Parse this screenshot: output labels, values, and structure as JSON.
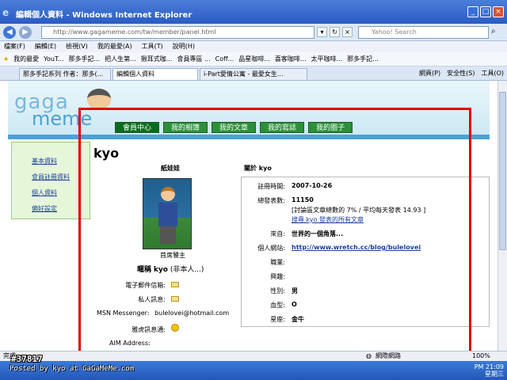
{
  "window": {
    "title": "編輯個人資料 - Windows Internet Explorer"
  },
  "address": {
    "url": "http://www.gagameme.com/tw/member/panel.html",
    "search_placeholder": "Yahoo! Search"
  },
  "menu": [
    "檔案(F)",
    "編輯(E)",
    "檢視(V)",
    "我的最愛(A)",
    "工具(T)",
    "說明(H)"
  ],
  "favorites": [
    "我的最愛",
    "YouT...",
    "那多手記...",
    "把人生第...",
    "揪耳式咖...",
    "會員專區 ...",
    "Coff...",
    "品星咖啡...",
    "喜客咖啡...",
    "太平咖啡...",
    "那多手記..."
  ],
  "tabs": [
    "那多手記系列 作者：那多(...",
    "編輯個人資料",
    "i-Part愛情公寓 - 最愛女生..."
  ],
  "command_bar": [
    "網頁(P)",
    "安全性(S)",
    "工具(O)"
  ],
  "site": {
    "logo_top": "gaga",
    "logo_bottom": "meme",
    "nav": [
      "會員中心",
      "我的相簿",
      "我的文章",
      "我的寫誌",
      "我的圈子"
    ]
  },
  "sidebar": [
    "基本資料",
    "會員註冊資料",
    "個人資料",
    "偏好設定"
  ],
  "profile": {
    "username": "kyo",
    "avatar_title": "紙娃娃",
    "avatar_caption": "首席饕主",
    "profile_label": "關於",
    "nickname_label": "暱稱",
    "nickname_value": "kyo",
    "nickname_note": "(非本人...)",
    "email_label": "電子郵件信箱:",
    "pm_label": "私人訊息:",
    "msn_label": "MSN Messenger:",
    "msn_value": "bulelovei@hotmail.com",
    "yahoo_label": "雅虎訊息通:",
    "aim_label": "AIM Address:"
  },
  "about": {
    "title": "關於 kyo",
    "rows": [
      {
        "k": "註冊時間:",
        "v": "2007-10-26"
      },
      {
        "k": "總發表數:",
        "v": "11150"
      },
      {
        "k": "",
        "v": "[討論區文章總數的 7% / 平均每天發表 14.93 ]"
      },
      {
        "k": "",
        "v": "搜尋 kyo 發表的所有文章"
      },
      {
        "k": "來自:",
        "v": "世界的一個角落..."
      },
      {
        "k": "個人網站:",
        "v": "http://www.wretch.cc/blog/bulelovei"
      },
      {
        "k": "職業:",
        "v": ""
      },
      {
        "k": "興趣:",
        "v": ""
      },
      {
        "k": "性別:",
        "v": "男"
      },
      {
        "k": "血型:",
        "v": "O"
      },
      {
        "k": "星座:",
        "v": "金牛"
      }
    ]
  },
  "status": {
    "done": "完成",
    "zone": "網際網路",
    "zoom": "100%"
  },
  "watermark": {
    "id": "#37817",
    "credit": "Posted by kyo at GaGaMeMe.com"
  },
  "tray": {
    "time": "PM 21:09",
    "day": "星期三"
  }
}
